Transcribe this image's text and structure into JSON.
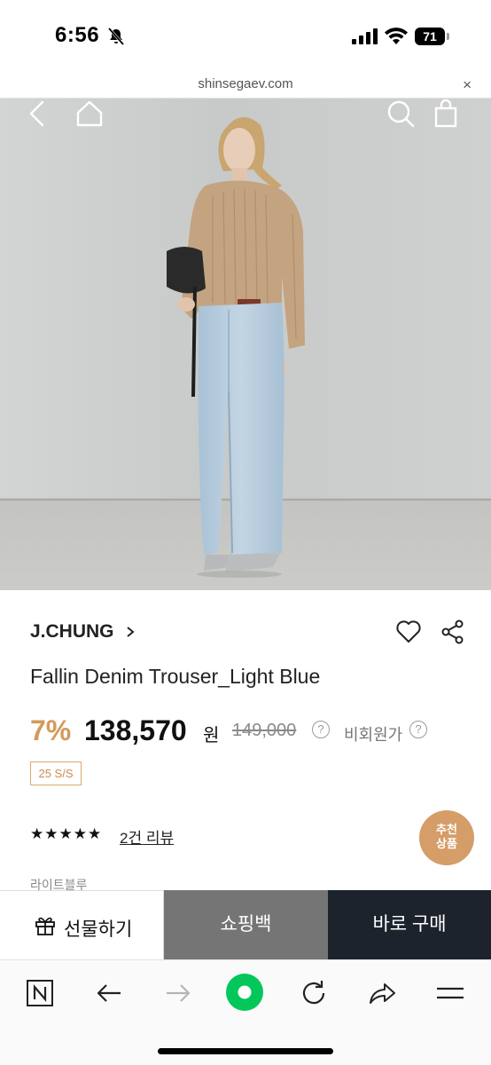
{
  "status_bar": {
    "time": "6:56",
    "battery_level": "71"
  },
  "browser": {
    "url": "shinsegaev.com",
    "close_label": "×"
  },
  "hero": {
    "image_description_icon_names": [
      "back-icon",
      "home-icon",
      "search-icon",
      "bag-icon"
    ]
  },
  "product": {
    "brand": "J.CHUNG",
    "title": "Fallin Denim Trouser_Light Blue",
    "discount": "7%",
    "price": "138,570",
    "currency": "원",
    "original_price": "149,000",
    "member_price_label": "비회원가",
    "help_mark": "?",
    "season": "25 S/S",
    "rating_stars": "★★★★★",
    "review_link": "2건 리뷰",
    "recommend_label_line1": "추천",
    "recommend_label_line2": "상품",
    "color_label": "라이트블루"
  },
  "actions": {
    "gift_label": "선물하기",
    "bag_label": "쇼핑백",
    "buy_label": "바로 구매"
  },
  "colors": {
    "accent": "#d39a5c",
    "buy_button": "#1c232c",
    "bag_button": "#757575",
    "naver_green": "#03c75a"
  }
}
